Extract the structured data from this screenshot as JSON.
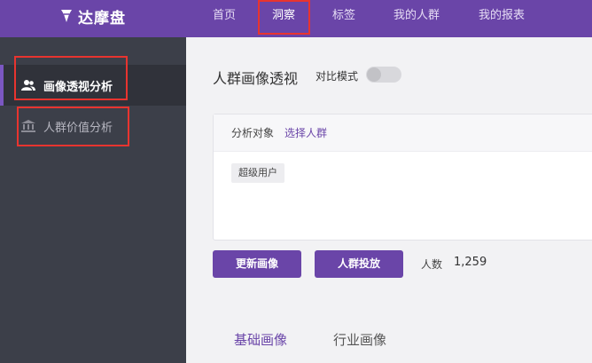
{
  "brand": {
    "name": "达摩盘",
    "icon": "diamond-logo-icon"
  },
  "topnav": [
    {
      "label": "首页"
    },
    {
      "label": "洞察",
      "active": true
    },
    {
      "label": "标签"
    },
    {
      "label": "我的人群"
    },
    {
      "label": "我的报表"
    }
  ],
  "sidebar": {
    "items": [
      {
        "label": "画像透视分析",
        "icon": "people-icon",
        "active": true
      },
      {
        "label": "人群价值分析",
        "icon": "bank-icon"
      }
    ]
  },
  "main": {
    "title": "人群画像透视",
    "compare_mode": {
      "label": "对比模式",
      "enabled": false
    },
    "target": {
      "label": "分析对象",
      "action": "选择人群",
      "selected": "超级用户"
    },
    "buttons": {
      "refresh": "更新画像",
      "deliver": "人群投放"
    },
    "count": {
      "label": "人数",
      "value": "1,259"
    },
    "tabs": [
      {
        "label": "基础画像",
        "active": true
      },
      {
        "label": "行业画像"
      }
    ]
  },
  "colors": {
    "brand": "#6a45a8",
    "sidebar": "#3c3f49",
    "highlight": "#e8342f"
  }
}
